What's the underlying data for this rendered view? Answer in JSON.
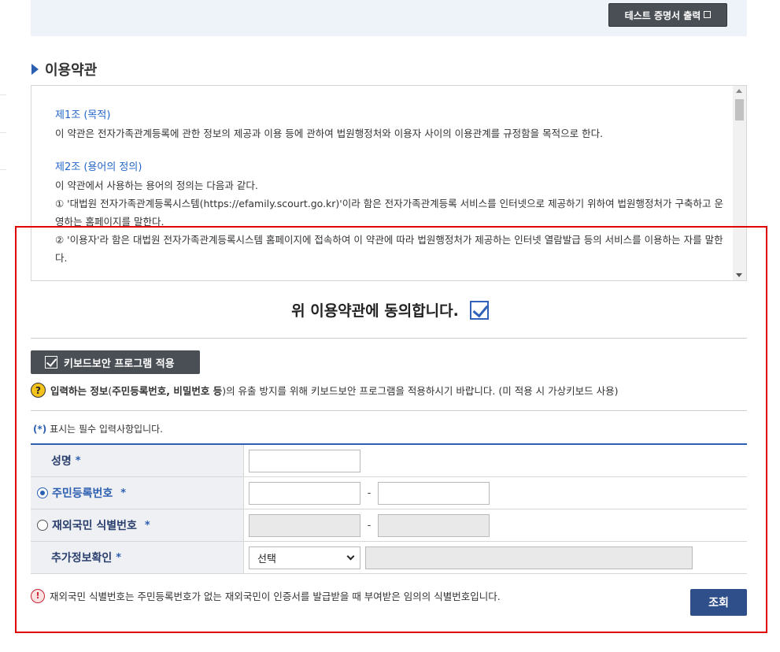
{
  "top": {
    "test_cert_button": "테스트 증명서 출력"
  },
  "section": {
    "title": "이용약관"
  },
  "terms": {
    "art1_title": "제1조 (목적)",
    "art1_body": "이 약관은 전자가족관계등록에 관한 정보의 제공과 이용 등에 관하여 법원행정처와 이용자 사이의 이용관계를 규정함을 목적으로 한다.",
    "art2_title": "제2조 (용어의 정의)",
    "art2_intro": "이 약관에서 사용하는 용어의 정의는 다음과 같다.",
    "art2_item1": "① '대법원 전자가족관계등록시스템(https://efamily.scourt.go.kr)'이라 함은 전자가족관계등록 서비스를 인터넷으로 제공하기 위하여 법원행정처가 구축하고 운영하는 홈페이지를 말한다.",
    "art2_item2": "② '이용자'라 함은 대법원 전자가족관계등록시스템 홈페이지에 접속하여 이 약관에 따라 법원행정처가 제공하는 인터넷 열람발급 등의 서비스를 이용하는 자를 말한다."
  },
  "agree": {
    "text": "위 이용약관에 동의합니다.",
    "checked": true
  },
  "keyboard": {
    "button_label": "키보드보안 프로그램 적용",
    "notice_bold": "입력하는 정보",
    "notice_mid": "(",
    "notice_bold2": "주민등록번호, 비밀번호 등",
    "notice_rest": ")의 유출 방지를 위해 키보드보안 프로그램을 적용하시기 바랍니다. (미 적용 시 가상키보드 사용)"
  },
  "required_note": {
    "star": "(*)",
    "text": " 표시는 필수 입력사항입니다."
  },
  "form": {
    "name_label": "성명",
    "rrn_label": "주민등록번호",
    "foreign_label": "재외국민 식별번호",
    "extra_label": "추가정보확인",
    "star": "*",
    "dash": "-",
    "select_value": "선택"
  },
  "warning": {
    "text": "재외국민 식별번호는 주민등록번호가 없는 재외국민이 인증서를 발급받을 때 부여받은 임의의 식별번호입니다."
  },
  "query_button": "조회",
  "colors": {
    "accent": "#2d5fb0",
    "highlight_frame": "#e00000",
    "dark_button": "#4a4f55",
    "query_button": "#2f4f8a"
  }
}
